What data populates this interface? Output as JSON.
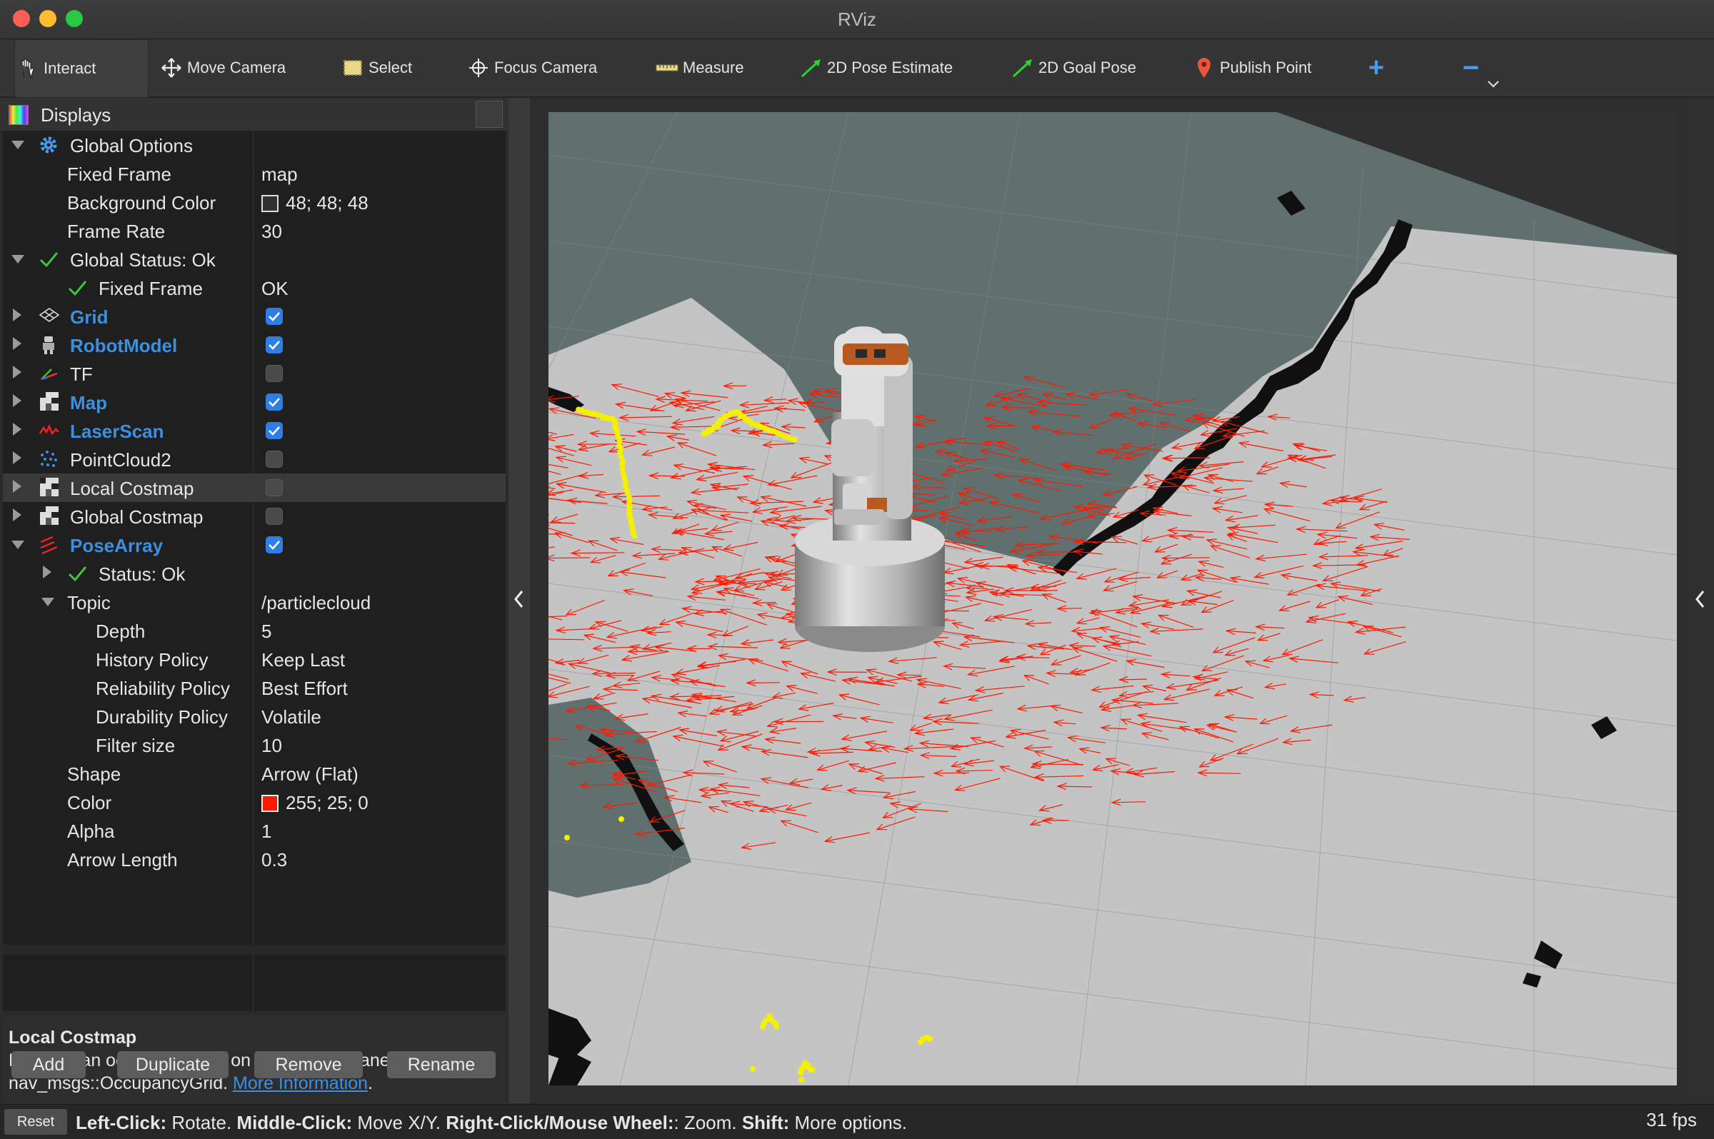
{
  "window": {
    "title": "RViz"
  },
  "toolbar": {
    "tools": [
      {
        "label": "Interact",
        "icon": "hand-icon"
      },
      {
        "label": "Move Camera",
        "icon": "move-arrows-icon"
      },
      {
        "label": "Select",
        "icon": "select-box-icon"
      },
      {
        "label": "Focus Camera",
        "icon": "crosshair-icon"
      },
      {
        "label": "Measure",
        "icon": "ruler-icon"
      },
      {
        "label": "2D Pose Estimate",
        "icon": "green-arrow-icon"
      },
      {
        "label": "2D Goal Pose",
        "icon": "green-arrow-icon"
      },
      {
        "label": "Publish Point",
        "icon": "map-pin-icon"
      }
    ],
    "add_symbol": "+",
    "remove_symbol": "−"
  },
  "displays": {
    "header": "Displays",
    "rows": [
      {
        "name": "Global Options",
        "value": ""
      },
      {
        "name": "Fixed Frame",
        "value": "map"
      },
      {
        "name": "Background Color",
        "value": "48; 48; 48"
      },
      {
        "name": "Frame Rate",
        "value": "30"
      },
      {
        "name": "Global Status: Ok",
        "value": ""
      },
      {
        "name": "Fixed Frame",
        "value": "OK"
      },
      {
        "name": "Grid",
        "value": ""
      },
      {
        "name": "RobotModel",
        "value": ""
      },
      {
        "name": "TF",
        "value": ""
      },
      {
        "name": "Map",
        "value": ""
      },
      {
        "name": "LaserScan",
        "value": ""
      },
      {
        "name": "PointCloud2",
        "value": ""
      },
      {
        "name": "Local Costmap",
        "value": ""
      },
      {
        "name": "Global Costmap",
        "value": ""
      },
      {
        "name": "PoseArray",
        "value": ""
      },
      {
        "name": "Status: Ok",
        "value": ""
      },
      {
        "name": "Topic",
        "value": "/particlecloud"
      },
      {
        "name": "Depth",
        "value": "5"
      },
      {
        "name": "History Policy",
        "value": "Keep Last"
      },
      {
        "name": "Reliability Policy",
        "value": "Best Effort"
      },
      {
        "name": "Durability Policy",
        "value": "Volatile"
      },
      {
        "name": "Filter size",
        "value": "10"
      },
      {
        "name": "Shape",
        "value": "Arrow (Flat)"
      },
      {
        "name": "Color",
        "value": "255; 25; 0"
      },
      {
        "name": "Alpha",
        "value": "1"
      },
      {
        "name": "Arrow Length",
        "value": "0.3"
      }
    ]
  },
  "description": {
    "title": "Local Costmap",
    "text_line1": "Displays an occupancy grid on the ground plane from a",
    "text_line2": "nav_msgs::OccupancyGrid.",
    "link": "More Information",
    "period": "."
  },
  "buttons": {
    "add": "Add",
    "duplicate": "Duplicate",
    "remove": "Remove",
    "rename": "Rename"
  },
  "statusbar": {
    "reset": "Reset",
    "hint_b1": "Left-Click:",
    "hint_t1": " Rotate. ",
    "hint_b2": "Middle-Click:",
    "hint_t2": " Move X/Y. ",
    "hint_b3": "Right-Click/Mouse Wheel:",
    "hint_t3": ": Zoom. ",
    "hint_b4": "Shift:",
    "hint_t4": " More options.",
    "fps": "31 fps"
  },
  "colors": {
    "accent_blue": "#3d8fe0",
    "checkbox_blue": "#2f7ee6",
    "particle_red": "#ff1900",
    "laser_yellow": "#f5f000",
    "map_free": "#c4c4c4",
    "map_unknown": "#5f706e"
  }
}
